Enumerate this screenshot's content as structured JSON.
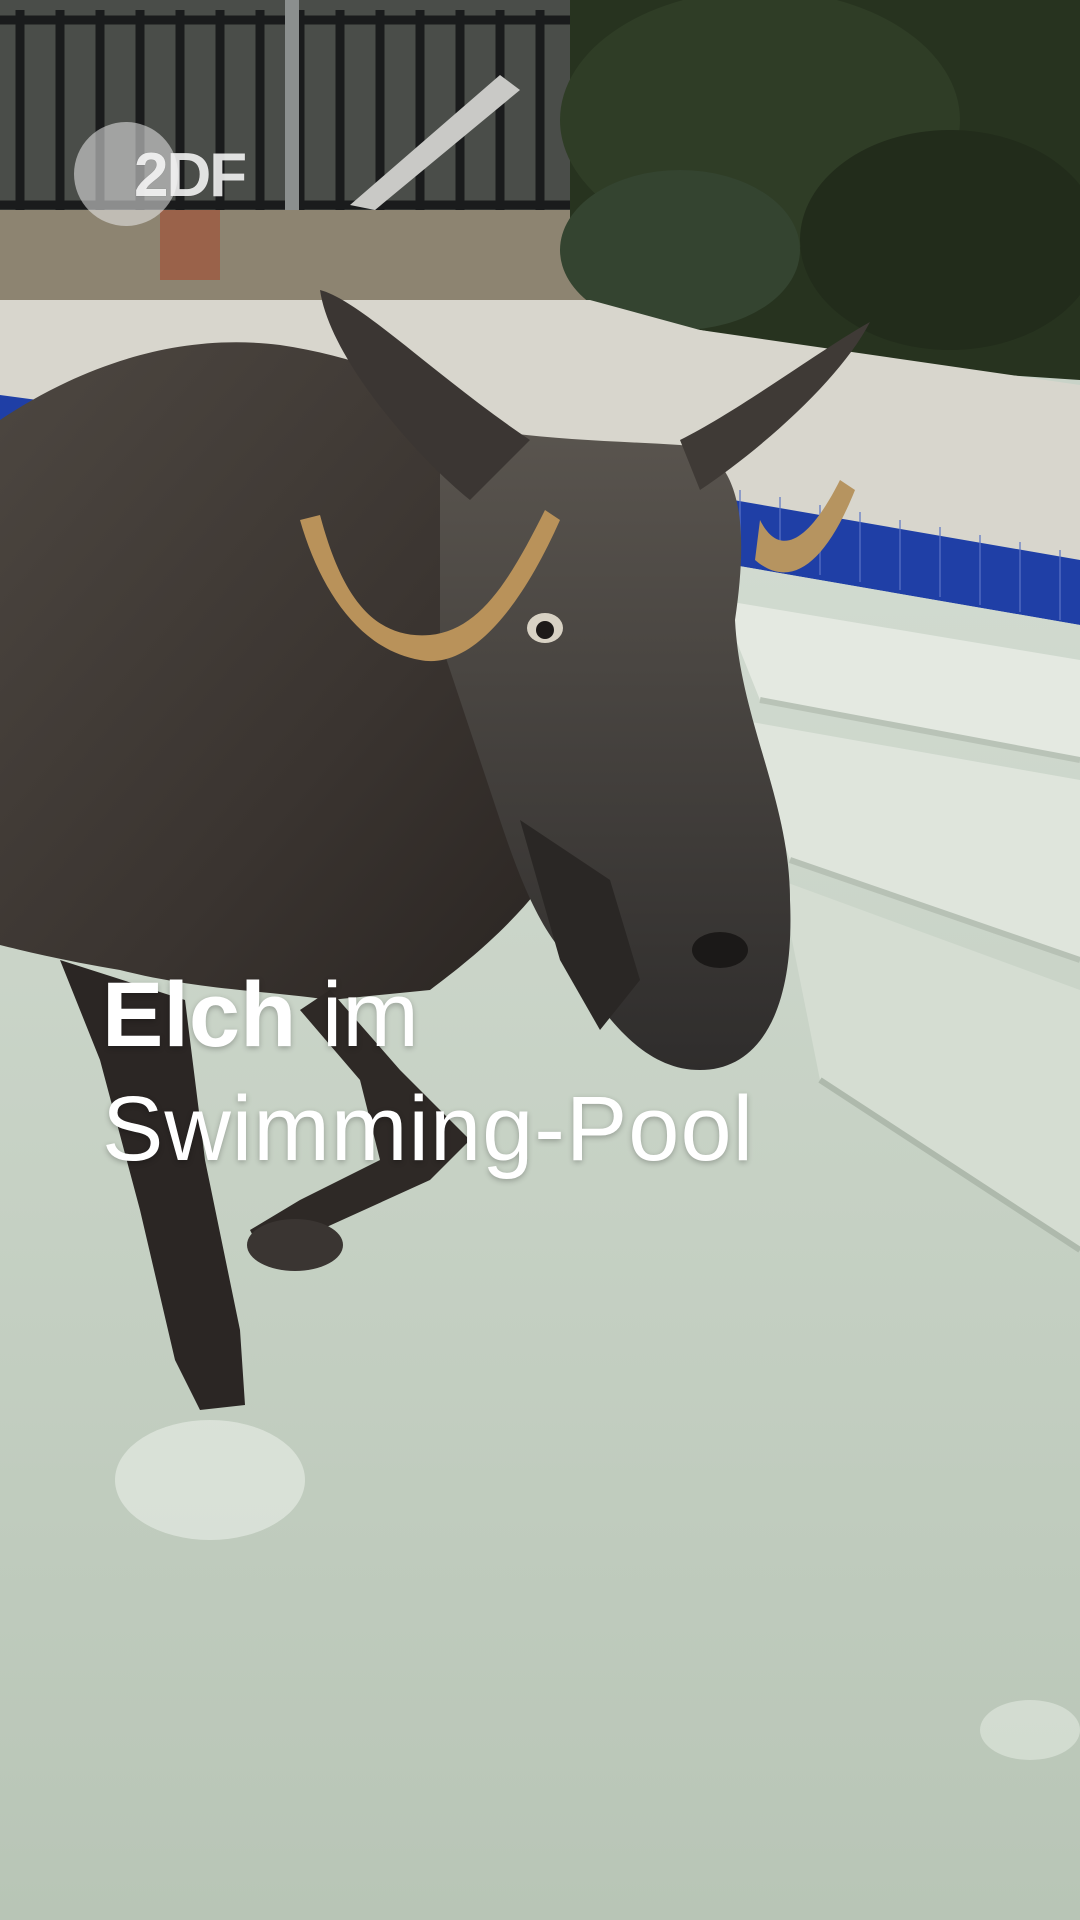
{
  "logo": {
    "text": "2DF"
  },
  "caption": {
    "line1_bold": "Elch",
    "line1_rest": " im",
    "line2": "Swimming-Pool"
  },
  "colors": {
    "pool_water": "#c9d3c8",
    "pool_tile": "#1f3fa6",
    "moose_fur": "#3b3530",
    "hedge": "#27331f"
  },
  "icons": [
    "zdf-logo",
    "moose-photo"
  ]
}
